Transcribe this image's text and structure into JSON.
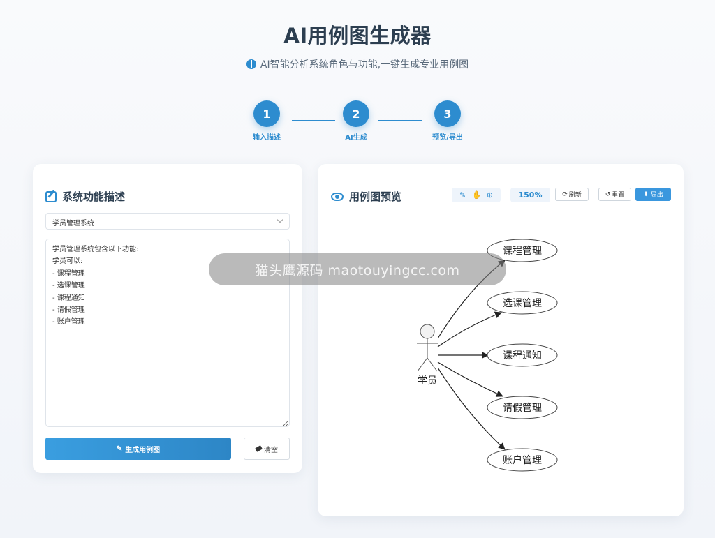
{
  "header": {
    "title": "AI用例图生成器",
    "subtitle": "AI智能分析系统角色与功能,一键生成专业用例图"
  },
  "steps": [
    {
      "number": "1",
      "label": "输入描述"
    },
    {
      "number": "2",
      "label": "AI生成"
    },
    {
      "number": "3",
      "label": "预览/导出"
    }
  ],
  "left_panel": {
    "title": "系统功能描述",
    "system_select": "学员管理系统",
    "description": "学员管理系统包含以下功能:\n学员可以:\n- 课程管理\n- 选课管理\n- 课程通知\n- 请假管理\n- 账户管理",
    "generate_label": "生成用例图",
    "clear_label": "清空"
  },
  "right_panel": {
    "title": "用例图预览",
    "zoom": "150%",
    "refresh_label": "刷新",
    "reset_label": "重置",
    "export_label": "导出"
  },
  "diagram": {
    "actor": "学员",
    "use_cases": [
      "课程管理",
      "选课管理",
      "课程通知",
      "请假管理",
      "账户管理"
    ]
  },
  "watermark": "猫头鹰源码 maotouyingcc.com",
  "colors": {
    "accent": "#2d8ccf",
    "title": "#2c3e50"
  }
}
